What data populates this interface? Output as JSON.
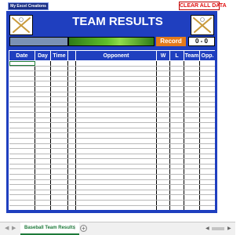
{
  "header": {
    "logo_label": "My Excel Creations",
    "clear_label": "CLEAR ALL DATA",
    "title": "TEAM RESULTS"
  },
  "record": {
    "label": "Record",
    "value": "0 - 0"
  },
  "table": {
    "columns": [
      "Date",
      "Day",
      "Time",
      "",
      "Opponent",
      "W",
      "L",
      "Team",
      "Opp."
    ]
  },
  "sheet_tabs": {
    "active": "Baseball Team Results",
    "add_symbol": "+"
  },
  "colors": {
    "frame": "#1f3fbf",
    "record_label": "#e47a1b",
    "clear": "#e01010",
    "tab_accent": "#1e7a3a"
  },
  "icons": [
    "bat-and-ball-icon",
    "bat-and-ball-icon"
  ]
}
